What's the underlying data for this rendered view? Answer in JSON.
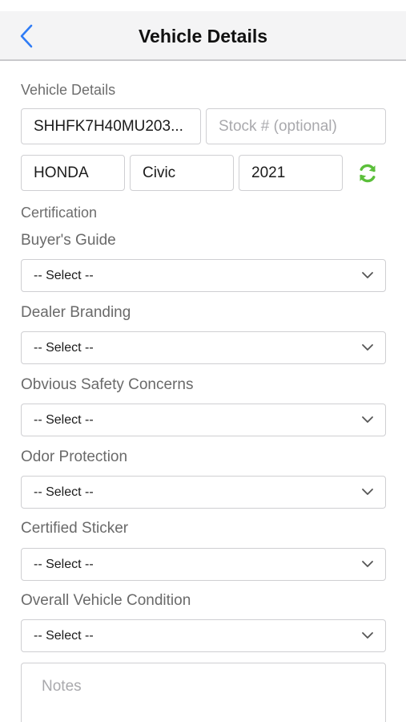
{
  "header": {
    "title": "Vehicle Details",
    "back_icon": "chevron-left-icon"
  },
  "vehicle_section": {
    "label": "Vehicle Details",
    "vin_value": "SHHFK7H40MU203...",
    "stock_placeholder": "Stock # (optional)",
    "make": "HONDA",
    "model": "Civic",
    "year": "2021",
    "refresh_icon": "refresh-icon",
    "refresh_color": "#5bbf3a"
  },
  "certification": {
    "label": "Certification",
    "fields": [
      {
        "label": "Buyer's Guide",
        "selected": "-- Select --"
      },
      {
        "label": "Dealer Branding",
        "selected": "-- Select --"
      },
      {
        "label": "Obvious Safety Concerns",
        "selected": "-- Select --"
      },
      {
        "label": "Odor Protection",
        "selected": "-- Select --"
      },
      {
        "label": "Certified Sticker",
        "selected": "-- Select --"
      },
      {
        "label": "Overall Vehicle Condition",
        "selected": "-- Select --"
      }
    ]
  },
  "notes": {
    "placeholder": "Notes"
  }
}
